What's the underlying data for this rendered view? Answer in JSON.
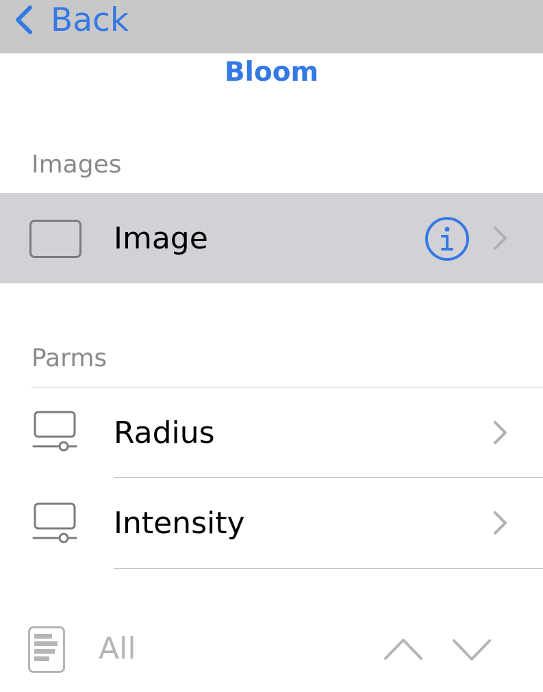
{
  "navbar": {
    "back_label": "Back"
  },
  "title": "Bloom",
  "sections": {
    "images": {
      "header": "Images",
      "rows": [
        {
          "label": "Image"
        }
      ]
    },
    "parms": {
      "header": "Parms",
      "rows": [
        {
          "label": "Radius"
        },
        {
          "label": "Intensity"
        }
      ]
    }
  },
  "toolbar": {
    "filter_label": "All"
  },
  "colors": {
    "accent": "#3478e4",
    "navbar_bg": "#c8c8c8",
    "selected_row_bg": "#d1d1d6",
    "secondary_text": "#8a8a8e",
    "disabled": "#b5b5b8"
  },
  "icons": {
    "back": "chevron-left-icon",
    "image_row": "image-frame-icon",
    "info": "info-circle-icon",
    "disclosure": "chevron-right-icon",
    "param_row": "slider-parameter-icon",
    "toolbar_doc": "document-list-icon",
    "up": "chevron-up-icon",
    "down": "chevron-down-icon"
  }
}
